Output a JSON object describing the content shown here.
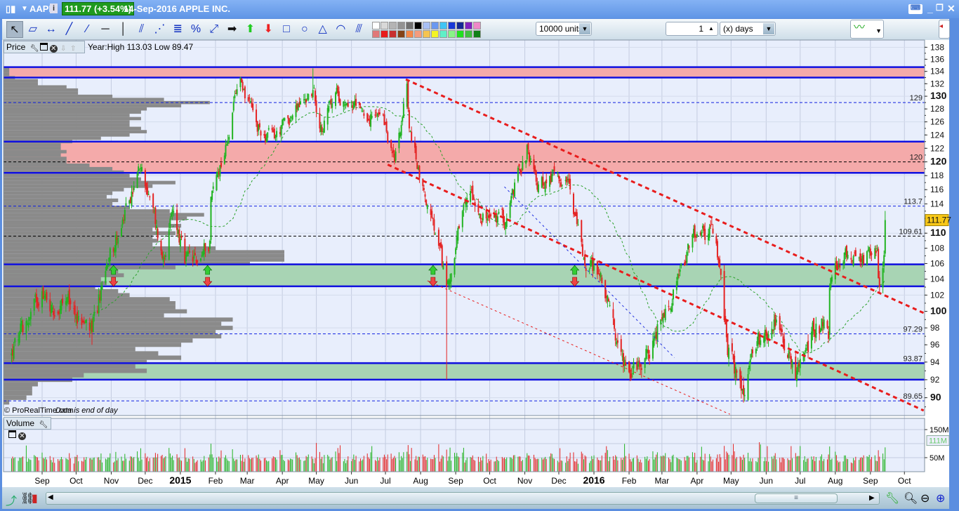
{
  "title": {
    "symbol": "AAPL",
    "price": "111.77 (+3.54%)",
    "desc": "14-Sep-2016 APPLE INC."
  },
  "toolbar": {
    "tools": [
      [
        "pointer",
        "↖"
      ],
      [
        "ruler",
        "▱"
      ],
      [
        "measure",
        "↔"
      ],
      [
        "line",
        "╱"
      ],
      [
        "segment",
        "⁄"
      ],
      [
        "horizontal-line",
        "─"
      ],
      [
        "vertical-line",
        "│"
      ],
      [
        "channel",
        "⫽"
      ],
      [
        "fan",
        "⋰"
      ],
      [
        "fibonacci",
        "≣"
      ],
      [
        "percent",
        "%"
      ],
      [
        "point",
        "⤢"
      ],
      [
        "right-arrow",
        "➡"
      ],
      [
        "up-arrow",
        "⬆"
      ],
      [
        "down-arrow",
        "⬇"
      ],
      [
        "rectangle",
        "□"
      ],
      [
        "ellipse",
        "○"
      ],
      [
        "triangle",
        "△"
      ],
      [
        "arc",
        "◠"
      ],
      [
        "gann",
        "⫻"
      ]
    ],
    "palette": [
      [
        "#ffffff",
        "#d8d8d8",
        "#b4b4b4",
        "#929292",
        "#707070",
        "#000000",
        "#a8c0f4",
        "#6a98f0",
        "#40c4f4",
        "#1838d8",
        "#142894",
        "#8020c0",
        "#f088c8"
      ],
      [
        "#e07878",
        "#e81c1c",
        "#c83030",
        "#844418",
        "#f48848",
        "#f49c7c",
        "#f4c450",
        "#f4f424",
        "#60f0c8",
        "#88f488",
        "#20e020",
        "#40c040",
        "#108018"
      ]
    ],
    "units": "10000 units",
    "period_value": "1",
    "period_unit": "(x) days"
  },
  "price_panel": {
    "label": "Price",
    "info": "Year:High 113.03 Low 89.47",
    "copyright": "© ProRealTime.com",
    "data_note": "Data is end of day"
  },
  "volume_panel": {
    "label": "Volume"
  },
  "chart_data": {
    "type": "candlestick",
    "title": "AAPL daily",
    "yscale": "log",
    "ylim": [
      88.5,
      138.5
    ],
    "yticks": [
      90,
      92,
      94,
      96,
      98,
      100,
      102,
      104,
      106,
      108,
      110,
      112,
      114,
      116,
      118,
      120,
      122,
      124,
      126,
      128,
      130,
      132,
      134,
      136,
      138
    ],
    "last_price": "111.77",
    "xticks": [
      [
        "2014-09-01",
        "Sep"
      ],
      [
        "2014-10-01",
        "Oct"
      ],
      [
        "2014-11-01",
        "Nov"
      ],
      [
        "2014-12-01",
        "Dec"
      ],
      [
        "2015-01-01",
        "2015"
      ],
      [
        "2015-02-01",
        "Feb"
      ],
      [
        "2015-03-01",
        "Mar"
      ],
      [
        "2015-04-01",
        "Apr"
      ],
      [
        "2015-05-01",
        "May"
      ],
      [
        "2015-06-01",
        "Jun"
      ],
      [
        "2015-07-01",
        "Jul"
      ],
      [
        "2015-08-01",
        "Aug"
      ],
      [
        "2015-09-01",
        "Sep"
      ],
      [
        "2015-10-01",
        "Oct"
      ],
      [
        "2015-11-01",
        "Nov"
      ],
      [
        "2015-12-01",
        "Dec"
      ],
      [
        "2016-01-01",
        "2016"
      ],
      [
        "2016-02-01",
        "Feb"
      ],
      [
        "2016-03-01",
        "Mar"
      ],
      [
        "2016-04-01",
        "Apr"
      ],
      [
        "2016-05-01",
        "May"
      ],
      [
        "2016-06-01",
        "Jun"
      ],
      [
        "2016-07-01",
        "Jul"
      ],
      [
        "2016-08-01",
        "Aug"
      ],
      [
        "2016-09-01",
        "Sep"
      ],
      [
        "2016-10-01",
        "Oct"
      ]
    ],
    "close_path": [
      [
        "2014-08-05",
        95
      ],
      [
        "2014-08-15",
        97.5
      ],
      [
        "2014-09-01",
        102.5
      ],
      [
        "2014-09-10",
        100.5
      ],
      [
        "2014-09-19",
        101
      ],
      [
        "2014-10-01",
        99.5
      ],
      [
        "2014-10-15",
        97.5,
        96
      ],
      [
        "2014-10-20",
        99.8
      ],
      [
        "2014-10-31",
        108
      ],
      [
        "2014-11-15",
        113
      ],
      [
        "2014-11-26",
        119
      ],
      [
        "2014-12-05",
        115
      ],
      [
        "2014-12-16",
        106.7
      ],
      [
        "2014-12-26",
        113
      ],
      [
        "2015-01-05",
        106
      ],
      [
        "2015-01-15",
        106
      ],
      [
        "2015-01-27",
        109
      ],
      [
        "2015-01-28",
        115
      ],
      [
        "2015-02-10",
        122.5
      ],
      [
        "2015-02-23",
        133
      ],
      [
        "2015-03-10",
        124.5
      ],
      [
        "2015-03-25",
        123.5
      ],
      [
        "2015-04-10",
        127
      ],
      [
        "2015-04-28",
        131,
        null,
        134.5
      ],
      [
        "2015-05-05",
        125.5
      ],
      [
        "2015-05-20",
        130.5
      ],
      [
        "2015-06-05",
        128.5
      ],
      [
        "2015-06-30",
        125.5
      ],
      [
        "2015-07-09",
        120
      ],
      [
        "2015-07-20",
        132
      ],
      [
        "2015-07-22",
        125
      ],
      [
        "2015-08-05",
        115
      ],
      [
        "2015-08-24",
        103,
        92
      ],
      [
        "2015-09-01",
        108
      ],
      [
        "2015-09-15",
        116
      ],
      [
        "2015-09-28",
        112
      ],
      [
        "2015-10-15",
        111.5
      ],
      [
        "2015-10-30",
        120
      ],
      [
        "2015-11-03",
        122.5
      ],
      [
        "2015-11-12",
        116
      ],
      [
        "2015-11-30",
        118.5
      ],
      [
        "2015-12-10",
        117
      ],
      [
        "2015-12-22",
        107
      ],
      [
        "2016-01-05",
        105
      ],
      [
        "2016-01-20",
        96.5
      ],
      [
        "2016-01-27",
        93.5
      ],
      [
        "2016-02-10",
        94
      ],
      [
        "2016-02-25",
        96.7
      ],
      [
        "2016-03-10",
        101
      ],
      [
        "2016-03-30",
        109.5
      ],
      [
        "2016-04-15",
        110
      ],
      [
        "2016-04-21",
        105.5
      ],
      [
        "2016-04-28",
        94.8
      ],
      [
        "2016-05-12",
        90.3,
        89.47
      ],
      [
        "2016-05-20",
        95
      ],
      [
        "2016-06-08",
        99
      ],
      [
        "2016-06-15",
        97.5
      ],
      [
        "2016-06-27",
        92
      ],
      [
        "2016-07-15",
        98.5
      ],
      [
        "2016-07-22",
        99
      ],
      [
        "2016-07-26",
        96.7
      ],
      [
        "2016-07-27",
        102.9
      ],
      [
        "2016-08-10",
        108
      ],
      [
        "2016-08-25",
        107
      ],
      [
        "2016-09-07",
        108
      ],
      [
        "2016-09-09",
        103
      ],
      [
        "2016-09-12",
        105.4
      ],
      [
        "2016-09-14",
        111.77,
        null,
        113.03
      ]
    ],
    "zones": [
      {
        "from": 133,
        "to": 134.7,
        "color": "#f4aaaa"
      },
      {
        "from": 118.4,
        "to": 123,
        "color": "#f4aaaa"
      },
      {
        "from": 103.1,
        "to": 105.9,
        "color": "#a8d4b4"
      },
      {
        "from": 92,
        "to": 93.87,
        "color": "#a8d4b4"
      }
    ],
    "levels": [
      {
        "price": 129,
        "label": "129",
        "color": "#1020e0"
      },
      {
        "price": 120,
        "label": "120",
        "color": "#000000"
      },
      {
        "price": 113.7,
        "label": "113.7",
        "color": "#1020e0"
      },
      {
        "price": 109.61,
        "label": "109.61",
        "color": "#000000"
      },
      {
        "price": 97.29,
        "label": "97.29",
        "color": "#1020e0"
      },
      {
        "price": 93.87,
        "label": "93.87",
        "color": "#1020e0"
      },
      {
        "price": 89.65,
        "label": "89.65",
        "color": "#1020e0"
      }
    ],
    "trendlines": [
      {
        "from": [
          "2015-07-19",
          132.7
        ],
        "to": [
          "2016-10-18",
          99.8
        ],
        "color": "#e81c1c",
        "width": 3
      },
      {
        "from": [
          "2015-07-03",
          119.6
        ],
        "to": [
          "2016-10-18",
          88.6
        ],
        "color": "#e81c1c",
        "width": 3
      },
      {
        "from": [
          "2015-08-07",
          103.8
        ],
        "to": [
          "2016-04-30",
          88.2
        ],
        "color": "#e81c1c",
        "width": 1
      },
      {
        "from": [
          "2015-10-14",
          116.4
        ],
        "to": [
          "2016-03-12",
          94.5
        ],
        "color": "#2030e0",
        "width": 1
      }
    ],
    "signals": [
      "2014-11-03",
      "2015-01-25",
      "2015-08-12",
      "2015-12-15"
    ],
    "volume_ticks": [
      [
        "150M",
        150
      ],
      [
        "50M",
        50
      ]
    ],
    "volume_last": "111M"
  },
  "colors": {
    "up": "#22b422",
    "down": "#e42424",
    "bg": "#e8eefc"
  }
}
